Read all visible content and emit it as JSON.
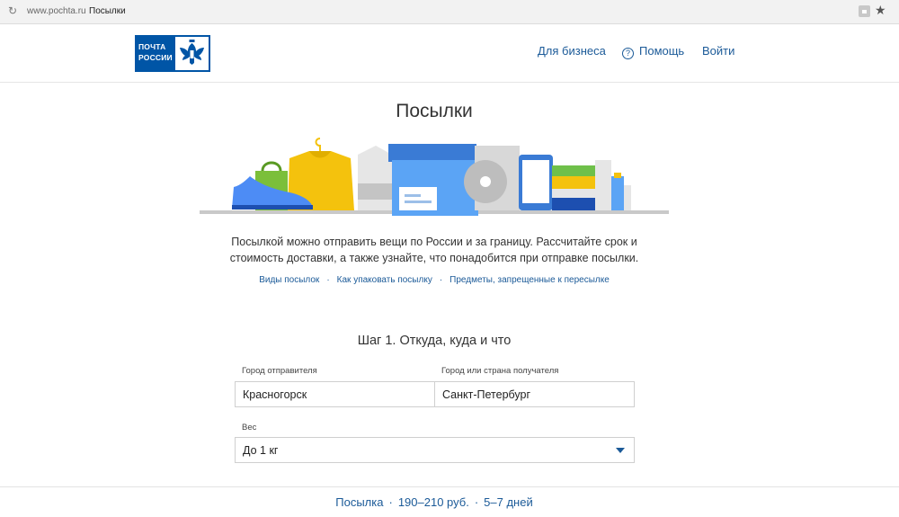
{
  "browser": {
    "url": "www.pochta.ru",
    "page": "Посылки"
  },
  "header": {
    "logo_text": [
      "ПОЧТА",
      "РОССИИ"
    ],
    "nav": {
      "business": "Для бизнеса",
      "help": "Помощь",
      "login": "Войти"
    }
  },
  "main": {
    "title": "Посылки",
    "intro_line1": "Посылкой можно отправить вещи по России и за границу. Рассчитайте срок и",
    "intro_line2": "стоимость доставки, а также узнайте, что понадобится при отправке посылки.",
    "links": [
      "Виды посылок",
      "Как упаковать посылку",
      "Предметы, запрещенные к пересылке"
    ],
    "link_separator": "·"
  },
  "form": {
    "step_title": "Шаг 1. Откуда, куда и что",
    "from_label": "Город отправителя",
    "from_value": "Красногорск",
    "to_label": "Город или страна получателя",
    "to_value": "Санкт-Петербург",
    "weight_label": "Вес",
    "weight_value": "До 1 кг"
  },
  "result": {
    "type": "Посылка",
    "price": "190–210 руб.",
    "term": "5–7 дней",
    "separator": "·"
  },
  "colors": {
    "brand": "#0055a6",
    "link": "#1b5a98"
  }
}
